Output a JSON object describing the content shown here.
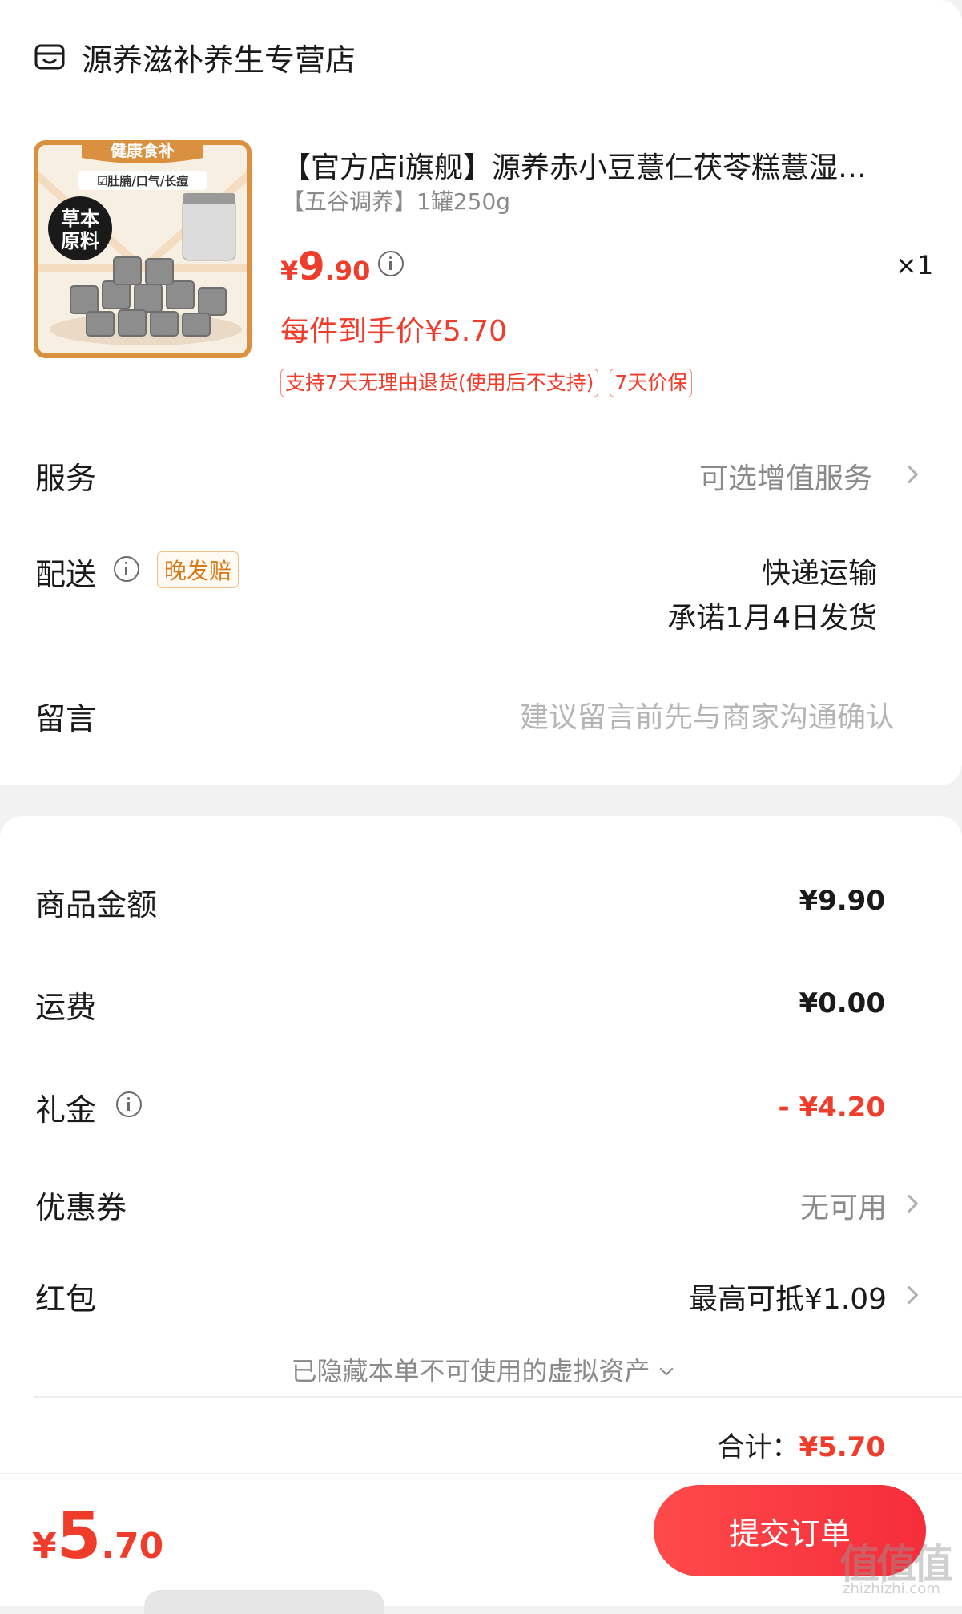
{
  "store": {
    "name": "源养滋补养生专营店",
    "icon": "store-icon"
  },
  "product": {
    "title": "【官方店i旗舰】源养赤小豆薏仁茯苓糕薏湿…",
    "spec": "【五谷调养】1罐250g",
    "price_symbol": "¥",
    "price_int": "9",
    "price_dec": ".90",
    "quantity": "×1",
    "final_price": "每件到手价¥5.70",
    "tags": [
      "支持7天无理由退货(使用后不支持)",
      "7天价保"
    ],
    "thumb": {
      "banner": "健康食补",
      "subtitle": "☑肚腩/口气/长痘",
      "badge_line1": "草本",
      "badge_line2": "原料"
    }
  },
  "service": {
    "label": "服务",
    "value": "可选增值服务"
  },
  "delivery": {
    "label": "配送",
    "badge": "晚发赔",
    "method": "快递运输",
    "promise": "承诺1月4日发货"
  },
  "message": {
    "label": "留言",
    "placeholder": "建议留言前先与商家沟通确认"
  },
  "summary": {
    "goods_label": "商品金额",
    "goods_value": "¥9.90",
    "shipping_label": "运费",
    "shipping_value": "¥0.00",
    "gift_label": "礼金",
    "gift_value": "- ¥4.20",
    "coupon_label": "优惠券",
    "coupon_value": "无可用",
    "redpacket_label": "红包",
    "redpacket_value": "最高可抵¥1.09",
    "hidden_assets": "已隐藏本单不可使用的虚拟资产",
    "total_label": "合计：",
    "total_value": "¥5.70"
  },
  "bottom": {
    "price_symbol": "¥",
    "price_int": "5",
    "price_dec": ".70",
    "submit_label": "提交订单"
  },
  "watermark": {
    "main": "值值值",
    "sub": "zhizhizhi.com"
  },
  "colors": {
    "accent": "#f03c2a",
    "button": "#f52d3a"
  }
}
